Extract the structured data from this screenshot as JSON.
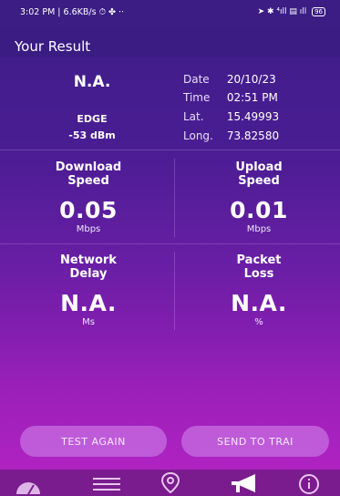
{
  "status_bar": {
    "time_speed": "3:02 PM | 6.6KB/s",
    "extra_icons": "⏱ ✤ ⋅⋅",
    "right_icons": "➤ ✱ ⁴ıll ▤ ıll",
    "battery": "96"
  },
  "header": {
    "title": "Your Result"
  },
  "summary": {
    "network_type": "N.A.",
    "connection": "EDGE",
    "signal_strength": "-53 dBm",
    "meta": [
      {
        "key": "Date",
        "value": "20/10/23"
      },
      {
        "key": "Time",
        "value": "02:51 PM"
      },
      {
        "key": "Lat.",
        "value": "15.49993"
      },
      {
        "key": "Long.",
        "value": "73.82580"
      }
    ]
  },
  "metrics": {
    "download": {
      "label_line1": "Download",
      "label_line2": "Speed",
      "value": "0.05",
      "unit": "Mbps"
    },
    "upload": {
      "label_line1": "Upload",
      "label_line2": "Speed",
      "value": "0.01",
      "unit": "Mbps"
    },
    "delay": {
      "label_line1": "Network",
      "label_line2": "Delay",
      "value": "N.A.",
      "unit": "Ms"
    },
    "loss": {
      "label_line1": "Packet",
      "label_line2": "Loss",
      "value": "N.A.",
      "unit": "%"
    }
  },
  "actions": {
    "test_again_label": "TEST AGAIN",
    "send_label": "SEND TO TRAI"
  },
  "nav": {
    "items": [
      {
        "icon": "speedometer-icon"
      },
      {
        "icon": "list-icon"
      },
      {
        "icon": "location-pin-icon"
      },
      {
        "icon": "megaphone-icon"
      },
      {
        "icon": "info-icon"
      }
    ]
  },
  "colors": {
    "header": "#3a1c83",
    "button": "#bf5bd9",
    "navbar": "#7a1c8d"
  }
}
